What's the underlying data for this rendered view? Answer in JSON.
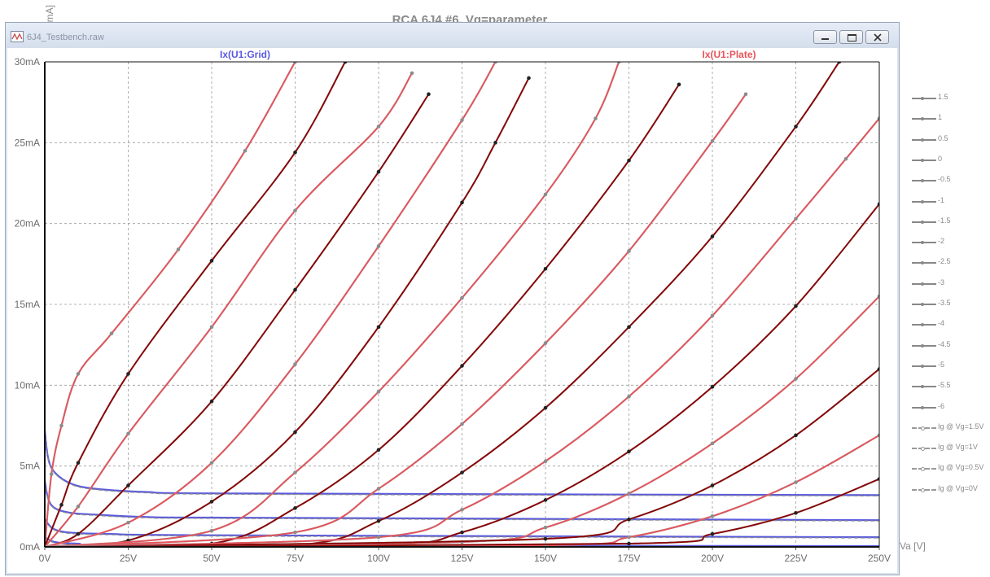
{
  "title": "RCA 6J4 #6, Vg=parameter",
  "yaxis_title": "Ia, Ig [mA]",
  "window": {
    "title": "6J4_Testbench.raw",
    "controls": [
      "minimize",
      "maximize",
      "close"
    ]
  },
  "colors": {
    "plate": "#e8535a",
    "plate_dark": "#8b0000",
    "grid": "#5a5ae0",
    "measured": "#999999",
    "background": "#ffffff"
  },
  "chart_data": {
    "type": "line",
    "title": "RCA 6J4 #6, Vg=parameter",
    "xlabel": "Va [V]",
    "ylabel": "Ia, Ig [mA]",
    "xlim": [
      0,
      250
    ],
    "ylim": [
      0,
      30
    ],
    "grid": true,
    "x_ticks": [
      "0V",
      "25V",
      "50V",
      "75V",
      "100V",
      "125V",
      "150V",
      "175V",
      "200V",
      "225V",
      "250V"
    ],
    "y_ticks": [
      "0mA",
      "5mA",
      "10mA",
      "15mA",
      "20mA",
      "25mA",
      "30mA"
    ],
    "trace_labels": [
      {
        "name": "Ix(U1:Grid)",
        "color": "#5a5ae0"
      },
      {
        "name": "Ix(U1:Plate)",
        "color": "#e8535a"
      }
    ],
    "legend_position": "right",
    "plate_series": [
      {
        "name": "1.5",
        "values": [
          [
            0,
            0
          ],
          [
            2,
            4.5
          ],
          [
            5,
            7.5
          ],
          [
            10,
            10.7
          ],
          [
            20,
            13.2
          ],
          [
            40,
            18.4
          ],
          [
            60,
            24.5
          ],
          [
            75,
            30
          ]
        ]
      },
      {
        "name": "1",
        "values": [
          [
            0,
            0
          ],
          [
            5,
            2.6
          ],
          [
            10,
            5.2
          ],
          [
            25,
            10.7
          ],
          [
            50,
            17.7
          ],
          [
            75,
            24.4
          ],
          [
            90,
            30
          ]
        ]
      },
      {
        "name": "0.5",
        "values": [
          [
            0,
            0
          ],
          [
            10,
            2.5
          ],
          [
            25,
            7.0
          ],
          [
            50,
            13.6
          ],
          [
            75,
            20.8
          ],
          [
            100,
            26.0
          ],
          [
            110,
            29.3
          ]
        ]
      },
      {
        "name": "0",
        "values": [
          [
            0,
            0
          ],
          [
            10,
            0.8
          ],
          [
            25,
            3.8
          ],
          [
            50,
            9.0
          ],
          [
            75,
            15.9
          ],
          [
            100,
            23.2
          ],
          [
            115,
            28.0
          ]
        ]
      },
      {
        "name": "-0.5",
        "values": [
          [
            0,
            0
          ],
          [
            25,
            1.5
          ],
          [
            50,
            5.2
          ],
          [
            75,
            11.3
          ],
          [
            100,
            18.6
          ],
          [
            125,
            26.4
          ],
          [
            135,
            30
          ]
        ]
      },
      {
        "name": "-1",
        "values": [
          [
            0,
            0
          ],
          [
            25,
            0.4
          ],
          [
            50,
            2.8
          ],
          [
            75,
            7.1
          ],
          [
            100,
            13.6
          ],
          [
            125,
            21.3
          ],
          [
            135,
            25.0
          ],
          [
            145,
            29.0
          ]
        ]
      },
      {
        "name": "-1.5",
        "values": [
          [
            0,
            0
          ],
          [
            50,
            1.0
          ],
          [
            75,
            4.6
          ],
          [
            100,
            9.6
          ],
          [
            125,
            15.4
          ],
          [
            150,
            21.8
          ],
          [
            165,
            26.5
          ],
          [
            172,
            30
          ]
        ]
      },
      {
        "name": "-2",
        "values": [
          [
            0,
            0
          ],
          [
            50,
            0.2
          ],
          [
            75,
            2.4
          ],
          [
            100,
            6.0
          ],
          [
            125,
            11.2
          ],
          [
            150,
            17.2
          ],
          [
            175,
            23.9
          ],
          [
            190,
            28.6
          ]
        ]
      },
      {
        "name": "-2.5",
        "values": [
          [
            0,
            0
          ],
          [
            75,
            0.9
          ],
          [
            100,
            3.6
          ],
          [
            125,
            7.6
          ],
          [
            150,
            12.6
          ],
          [
            175,
            18.3
          ],
          [
            200,
            25.1
          ],
          [
            210,
            28.0
          ]
        ]
      },
      {
        "name": "-3",
        "values": [
          [
            0,
            0
          ],
          [
            75,
            0.1
          ],
          [
            100,
            1.6
          ],
          [
            125,
            4.6
          ],
          [
            150,
            8.6
          ],
          [
            175,
            13.6
          ],
          [
            200,
            19.2
          ],
          [
            225,
            26.0
          ],
          [
            238,
            30
          ]
        ]
      },
      {
        "name": "-3.5",
        "values": [
          [
            0,
            0
          ],
          [
            100,
            0.6
          ],
          [
            125,
            2.3
          ],
          [
            150,
            5.3
          ],
          [
            175,
            9.3
          ],
          [
            200,
            14.3
          ],
          [
            225,
            20.3
          ],
          [
            240,
            24.0
          ],
          [
            250,
            26.5
          ]
        ]
      },
      {
        "name": "-4",
        "values": [
          [
            0,
            0
          ],
          [
            100,
            0.1
          ],
          [
            125,
            0.9
          ],
          [
            150,
            2.9
          ],
          [
            175,
            5.9
          ],
          [
            200,
            9.9
          ],
          [
            225,
            14.9
          ],
          [
            250,
            21.2
          ]
        ]
      },
      {
        "name": "-4.5",
        "values": [
          [
            0,
            0
          ],
          [
            125,
            0.3
          ],
          [
            150,
            1.2
          ],
          [
            175,
            3.3
          ],
          [
            200,
            6.4
          ],
          [
            225,
            10.4
          ],
          [
            250,
            15.5
          ]
        ]
      },
      {
        "name": "-5",
        "values": [
          [
            0,
            0
          ],
          [
            150,
            0.5
          ],
          [
            175,
            1.7
          ],
          [
            200,
            3.8
          ],
          [
            225,
            6.9
          ],
          [
            250,
            11.0
          ]
        ]
      },
      {
        "name": "-5.5",
        "values": [
          [
            0,
            0
          ],
          [
            150,
            0.1
          ],
          [
            175,
            0.6
          ],
          [
            200,
            1.9
          ],
          [
            225,
            4.0
          ],
          [
            250,
            6.9
          ]
        ]
      },
      {
        "name": "-6",
        "values": [
          [
            0,
            0
          ],
          [
            175,
            0.2
          ],
          [
            200,
            0.8
          ],
          [
            225,
            2.1
          ],
          [
            250,
            4.2
          ]
        ]
      }
    ],
    "grid_series": [
      {
        "name": "Ig @ Vg=1.5V",
        "values": [
          [
            0,
            7.2
          ],
          [
            1,
            5.5
          ],
          [
            3,
            4.6
          ],
          [
            8,
            3.9
          ],
          [
            15,
            3.6
          ],
          [
            30,
            3.4
          ],
          [
            60,
            3.3
          ],
          [
            250,
            3.2
          ]
        ]
      },
      {
        "name": "Ig @ Vg=1V",
        "values": [
          [
            0,
            4.1
          ],
          [
            1,
            3.0
          ],
          [
            3,
            2.4
          ],
          [
            8,
            2.1
          ],
          [
            15,
            2.0
          ],
          [
            30,
            1.85
          ],
          [
            60,
            1.8
          ],
          [
            250,
            1.65
          ]
        ]
      },
      {
        "name": "Ig @ Vg=0.5V",
        "values": [
          [
            0,
            1.7
          ],
          [
            2,
            1.2
          ],
          [
            5,
            0.95
          ],
          [
            10,
            0.85
          ],
          [
            20,
            0.8
          ],
          [
            50,
            0.72
          ],
          [
            250,
            0.6
          ]
        ]
      },
      {
        "name": "Ig @ Vg=0V",
        "values": [
          [
            0,
            0.6
          ],
          [
            3,
            0.3
          ],
          [
            10,
            0.2
          ],
          [
            30,
            0.1
          ],
          [
            250,
            0.05
          ]
        ]
      }
    ],
    "legend": [
      "1.5",
      "1",
      "0.5",
      "0",
      "-0.5",
      "-1",
      "-1.5",
      "-2",
      "-2.5",
      "-3",
      "-3.5",
      "-4",
      "-4.5",
      "-5",
      "-5.5",
      "-6",
      "Ig @ Vg=1.5V",
      "Ig @ Vg=1V",
      "Ig @ Vg=0.5V",
      "Ig @ Vg=0V"
    ]
  }
}
